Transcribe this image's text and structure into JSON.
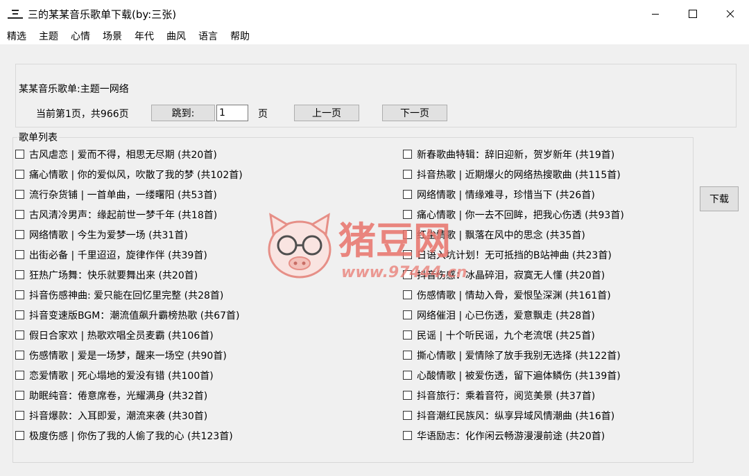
{
  "window": {
    "title": "三的某某音乐歌单下载(by:三张)"
  },
  "menu": [
    "精选",
    "主题",
    "心情",
    "场景",
    "年代",
    "曲风",
    "语言",
    "帮助"
  ],
  "header": {
    "playlist_label": "某某音乐歌单:主题一网络",
    "page_info": "当前第1页，共966页",
    "jump_label": "跳到:",
    "page_value": "1",
    "page_unit": "页",
    "prev_label": "上一页",
    "next_label": "下一页"
  },
  "list": {
    "legend": "歌单列表",
    "left": [
      "古风虐恋 | 爱而不得，相思无尽期 (共20首)",
      "痛心情歌 | 你的爱似风，吹散了我的梦 (共102首)",
      "流行杂货铺 | 一首单曲，一缕曙阳 (共53首)",
      "古风清冷男声：缘起前世一梦千年 (共18首)",
      "网络情歌 | 今生为爱梦一场 (共31首)",
      "出街必备 | 千里迢迢，旋律作伴 (共39首)",
      "狂热广场舞：快乐就要舞出来 (共20首)",
      "抖音伤感神曲: 爱只能在回忆里完整 (共28首)",
      "抖音变速版BGM：潮流值飙升霸榜热歌 (共67首)",
      "假日合家欢 | 热歌欢唱全员麦霸 (共106首)",
      "伤感情歌 | 爱是一场梦，醒来一场空 (共90首)",
      "恋爱情歌 | 死心塌地的爱没有错 (共100首)",
      "助眠纯音：倦意席卷，光耀满身 (共32首)",
      "抖音爆款：入耳即爱，潮流来袭 (共30首)",
      "极度伤感 | 你伤了我的人偷了我的心 (共123首)"
    ],
    "right": [
      "新春歌曲特辑：辞旧迎新，贺岁新年 (共19首)",
      "抖音热歌 | 近期爆火的网络热搜歌曲 (共115首)",
      "网络情歌 | 情缘难寻，珍惜当下 (共26首)",
      "痛心情歌 | 你一去不回眸，把我心伤透 (共93首)",
      "红尘情歌 | 飘落在风中的思念 (共35首)",
      "日语入坑计划！无可抵挡的B站神曲 (共23首)",
      "抖音伤感：冰晶碎泪，寂寞无人懂 (共20首)",
      "伤感情歌 | 情劫入骨，爱恨坠深渊 (共161首)",
      "网络催泪 | 心已伤透，爱意飘走 (共28首)",
      "民谣 | 十个听民谣，九个老流氓 (共25首)",
      "撕心情歌 | 爱情除了放手我别无选择 (共122首)",
      "心酸情歌 | 被爱伤透，留下遍体鳞伤 (共139首)",
      "抖音旅行：乘着音符，阅览美景 (共37首)",
      "抖音潮红民族风：纵享异域风情潮曲 (共16首)",
      "华语励志：化作闲云畅游漫漫前途 (共20首)"
    ]
  },
  "download_label": "下载",
  "watermark": {
    "brand": "猪豆网",
    "url": "www.97444.cn"
  }
}
